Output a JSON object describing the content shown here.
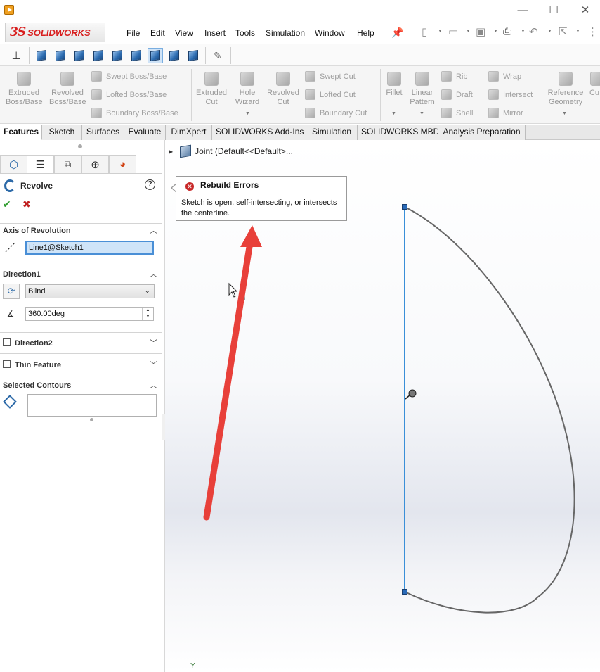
{
  "app": {
    "brand": "SOLIDWORKS",
    "brand_mark": "3S",
    "window_controls": [
      "—",
      "☐",
      "✕"
    ]
  },
  "menu": [
    "File",
    "Edit",
    "View",
    "Insert",
    "Tools",
    "Simulation",
    "Window",
    "Help"
  ],
  "ribbon": {
    "big_buttons": [
      {
        "label": "Extruded Boss/Base"
      },
      {
        "label": "Revolved Boss/Base"
      },
      {
        "label": "Extruded Cut"
      },
      {
        "label": "Hole Wizard"
      },
      {
        "label": "Revolved Cut"
      },
      {
        "label": "Fillet"
      },
      {
        "label": "Linear Pattern"
      },
      {
        "label": "Reference Geometry"
      },
      {
        "label": "Cu"
      }
    ],
    "small_buttons": [
      {
        "label": "Swept Boss/Base"
      },
      {
        "label": "Lofted Boss/Base"
      },
      {
        "label": "Boundary Boss/Base"
      },
      {
        "label": "Swept Cut"
      },
      {
        "label": "Lofted Cut"
      },
      {
        "label": "Boundary Cut"
      },
      {
        "label": "Rib"
      },
      {
        "label": "Draft"
      },
      {
        "label": "Shell"
      },
      {
        "label": "Wrap"
      },
      {
        "label": "Intersect"
      },
      {
        "label": "Mirror"
      }
    ]
  },
  "tabs": [
    "Features",
    "Sketch",
    "Surfaces",
    "Evaluate",
    "DimXpert",
    "SOLIDWORKS Add-Ins",
    "Simulation",
    "SOLIDWORKS MBD",
    "Analysis Preparation"
  ],
  "property_manager": {
    "title": "Revolve",
    "help": "?",
    "ok": "✔",
    "cancel": "✖",
    "axis_of_revolution": {
      "header": "Axis of Revolution",
      "value": "Line1@Sketch1"
    },
    "direction1": {
      "header": "Direction1",
      "type": "Blind",
      "angle": "360.00deg"
    },
    "direction2": {
      "header": "Direction2"
    },
    "thin_feature": {
      "header": "Thin Feature"
    },
    "selected_contours": {
      "header": "Selected Contours"
    }
  },
  "graphics": {
    "tree_item": "Joint  (Default<<Default>...",
    "error_popup": {
      "title": "Rebuild Errors",
      "message": "Sketch is open, self-intersecting, or intersects the centerline."
    },
    "axis_label": "Y"
  },
  "colors": {
    "accent_red": "#d81e1e",
    "annotation_arrow": "#e8403a",
    "centerline": "#3a8fd8",
    "sketch_curve": "#666666",
    "selection_blue": "#cfe4f8"
  }
}
